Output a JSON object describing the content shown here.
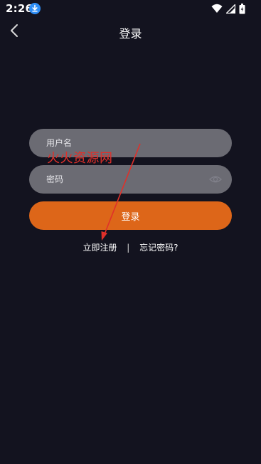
{
  "status_bar": {
    "time": "2:26",
    "icons": [
      "download-icon",
      "wifi-icon",
      "signal-icon",
      "battery-icon"
    ]
  },
  "header": {
    "back_icon": "chevron-left-icon",
    "title": "登录"
  },
  "form": {
    "username_placeholder": "用户名",
    "username_value": "",
    "password_placeholder": "密码",
    "password_value": "",
    "password_toggle_icon": "eye-icon",
    "login_label": "登录"
  },
  "links": {
    "register": "立即注册",
    "separator": "|",
    "forgot_password": "忘记密码?"
  },
  "watermark": {
    "text": "火火资源网"
  },
  "colors": {
    "background": "#13131f",
    "field": "#6b6b73",
    "accent": "#dd6619",
    "annotation": "#e0302a"
  }
}
